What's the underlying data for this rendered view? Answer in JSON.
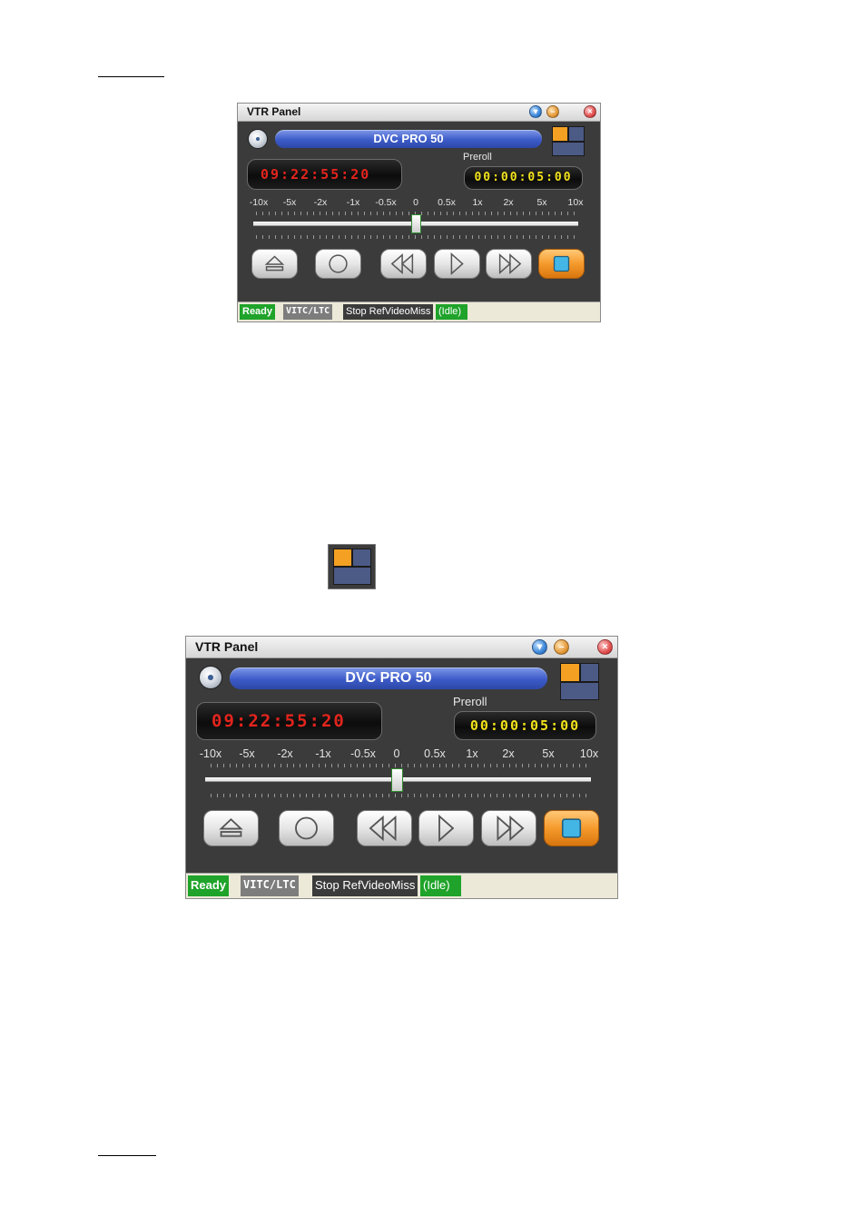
{
  "panels": [
    {
      "title": "VTR Panel",
      "device_name": "DVC PRO 50",
      "timecode": "09:22:55:20",
      "preroll_label": "Preroll",
      "preroll_value": "00:00:05:00",
      "speed_labels": [
        "-10x",
        "-5x",
        "-2x",
        "-1x",
        "-0.5x",
        "0",
        "0.5x",
        "1x",
        "2x",
        "5x",
        "10x"
      ],
      "speed_value": "0",
      "status": {
        "ready": "Ready",
        "tc_source": "VITC/LTC",
        "message": "Stop RefVideoMiss",
        "state": "(Idle)"
      }
    },
    {
      "title": "VTR Panel",
      "device_name": "DVC PRO 50",
      "timecode": "09:22:55:20",
      "preroll_label": "Preroll",
      "preroll_value": "00:00:05:00",
      "speed_labels": [
        "-10x",
        "-5x",
        "-2x",
        "-1x",
        "-0.5x",
        "0",
        "0.5x",
        "1x",
        "2x",
        "5x",
        "10x"
      ],
      "speed_value": "0",
      "status": {
        "ready": "Ready",
        "tc_source": "VITC/LTC",
        "message": "Stop RefVideoMiss",
        "state": "(Idle)"
      }
    }
  ],
  "icons": {
    "title_buttons": [
      "help-icon",
      "minimize-icon",
      "close-icon"
    ],
    "transport": [
      "eject-icon",
      "record-icon",
      "rewind-icon",
      "play-icon",
      "fast-forward-icon",
      "stop-icon"
    ],
    "device": "disc-icon",
    "layout": "layout-toggle-icon"
  },
  "colors": {
    "timecode": "#e3241d",
    "preroll": "#f2e21a",
    "accent_orange": "#f59a2c",
    "device_bar": "#3c5bc8",
    "ready_green": "#1fa32a"
  }
}
